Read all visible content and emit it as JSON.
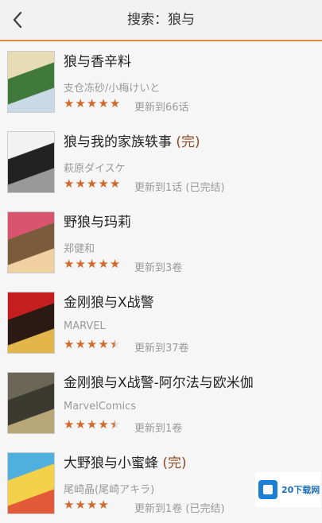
{
  "header": {
    "title": "搜索：狼与"
  },
  "results": [
    {
      "name": "狼与香辛料",
      "status": "",
      "author": "支仓冻砂/小梅けいと",
      "rating": 5,
      "update": "更新到66话",
      "cover_colors": [
        "#e8dcb6",
        "#3f7a3a",
        "#c9d9e6"
      ]
    },
    {
      "name": "狼与我的家族轶事",
      "status": "(完)",
      "author": "萩原ダイスケ",
      "rating": 5,
      "update": "更新到1话 (已完结)",
      "cover_colors": [
        "#f2f2f2",
        "#222222",
        "#999999"
      ]
    },
    {
      "name": "野狼与玛莉",
      "status": "",
      "author": "郑健和",
      "rating": 5,
      "update": "更新到3卷",
      "cover_colors": [
        "#d9556e",
        "#7a5b3c",
        "#f0d0a0"
      ]
    },
    {
      "name": "金刚狼与X战警",
      "status": "",
      "author": "MARVEL",
      "rating": 4.5,
      "update": "更新到37卷",
      "cover_colors": [
        "#c41e1e",
        "#2b1a14",
        "#e2b64a"
      ]
    },
    {
      "name": "金刚狼与X战警-阿尔法与欧米伽",
      "status": "",
      "author": "MarvelComics",
      "rating": 4.5,
      "update": "更新到1卷",
      "cover_colors": [
        "#6b6655",
        "#3a3a30",
        "#b8a878"
      ]
    },
    {
      "name": "大野狼与小蜜蜂",
      "status": "(完)",
      "author": "尾崎晶(尾崎アキラ)",
      "rating": 4,
      "update": "更新到1卷 (已完结)",
      "cover_colors": [
        "#4fb0e0",
        "#f3d24a",
        "#e25a3a"
      ]
    }
  ],
  "colors": {
    "accent": "#e0893a",
    "star_filled": "#d1692c",
    "star_empty": "#dddddd",
    "done": "#8b4a23"
  },
  "watermark": {
    "text": "20下载网"
  }
}
